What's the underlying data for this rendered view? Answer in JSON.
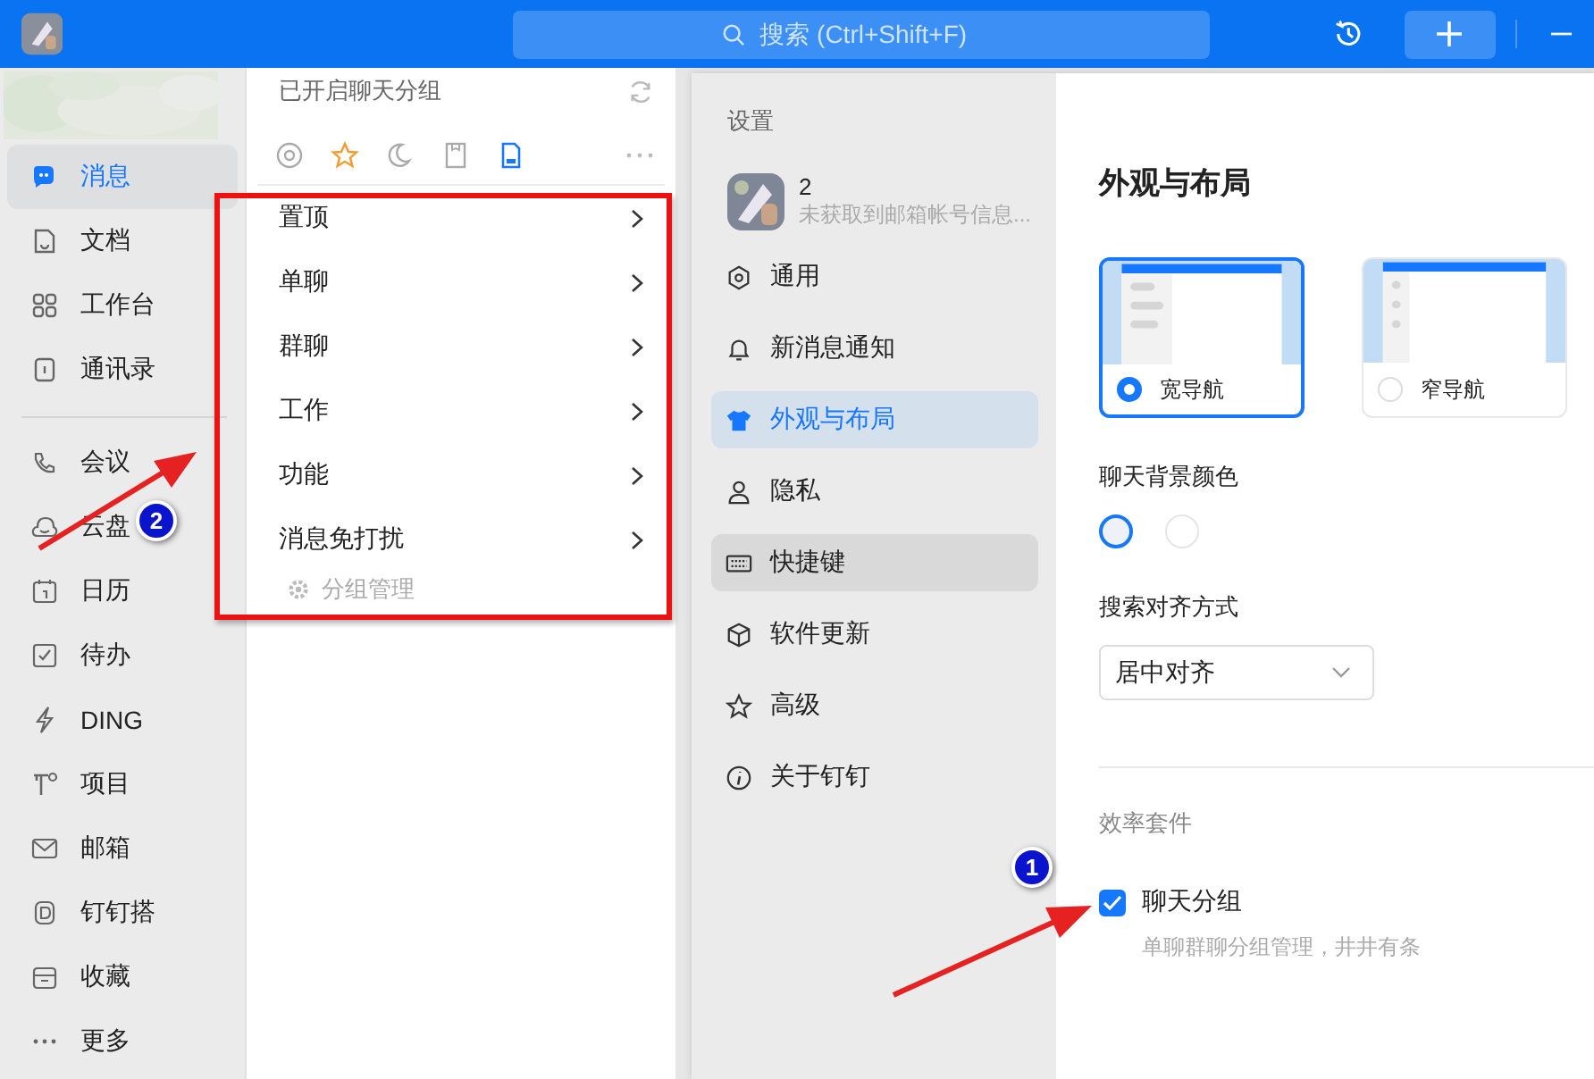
{
  "top_bar": {
    "search": {
      "placeholder": "搜索 (Ctrl+Shift+F)"
    }
  },
  "sidebar": {
    "items": [
      {
        "label": "消息",
        "selected": true
      },
      {
        "label": "文档",
        "selected": false
      },
      {
        "label": "工作台",
        "selected": false
      },
      {
        "label": "通讯录",
        "selected": false
      }
    ],
    "more_items": [
      {
        "label": "会议",
        "selected": false
      },
      {
        "label": "云盘",
        "selected": false
      },
      {
        "label": "日历",
        "selected": false
      },
      {
        "label": "待办",
        "selected": false
      },
      {
        "label": "DING",
        "selected": false
      },
      {
        "label": "项目",
        "selected": false
      },
      {
        "label": "邮箱",
        "selected": false
      },
      {
        "label": "钉钉搭",
        "selected": false
      },
      {
        "label": "收藏",
        "selected": false
      },
      {
        "label": "更多",
        "selected": false
      }
    ]
  },
  "group_panel": {
    "title": "已开启聊天分组",
    "filters": [
      {
        "selected": false
      },
      {
        "selected": false
      },
      {
        "selected": false
      },
      {
        "selected": false
      },
      {
        "selected": true
      }
    ],
    "menu": [
      "置顶",
      "单聊",
      "群聊",
      "工作",
      "功能",
      "消息免打扰"
    ],
    "manage": "分组管理"
  },
  "settings": {
    "title": "设置",
    "profile": {
      "name": "2",
      "subtitle": "未获取到邮箱帐号信息..."
    },
    "nav": [
      {
        "label": "通用",
        "selected": false,
        "hovered": false
      },
      {
        "label": "新消息通知",
        "selected": false,
        "hovered": false
      },
      {
        "label": "外观与布局",
        "selected": true,
        "hovered": false
      },
      {
        "label": "隐私",
        "selected": false,
        "hovered": false
      },
      {
        "label": "快捷键",
        "selected": false,
        "hovered": true
      },
      {
        "label": "软件更新",
        "selected": false,
        "hovered": false
      },
      {
        "label": "高级",
        "selected": false,
        "hovered": false
      },
      {
        "label": "关于钉钉",
        "selected": false,
        "hovered": false
      }
    ],
    "content": {
      "heading": "外观与布局",
      "nav_styles": [
        {
          "label": "宽导航",
          "selected": true
        },
        {
          "label": "窄导航",
          "selected": false
        }
      ],
      "background_label": "聊天背景颜色",
      "background_colors": [
        {
          "color": "#eef1f7",
          "selected": true
        },
        {
          "color": "#ffffff",
          "selected": false
        }
      ],
      "search_align": {
        "label": "搜索对齐方式",
        "value": "居中对齐"
      },
      "efficiency": {
        "title": "效率套件",
        "option": {
          "label": "聊天分组",
          "checked": true,
          "description": "单聊群聊分组管理，井井有条"
        }
      }
    }
  },
  "annotations": [
    {
      "number": "2"
    },
    {
      "number": "1"
    }
  ]
}
